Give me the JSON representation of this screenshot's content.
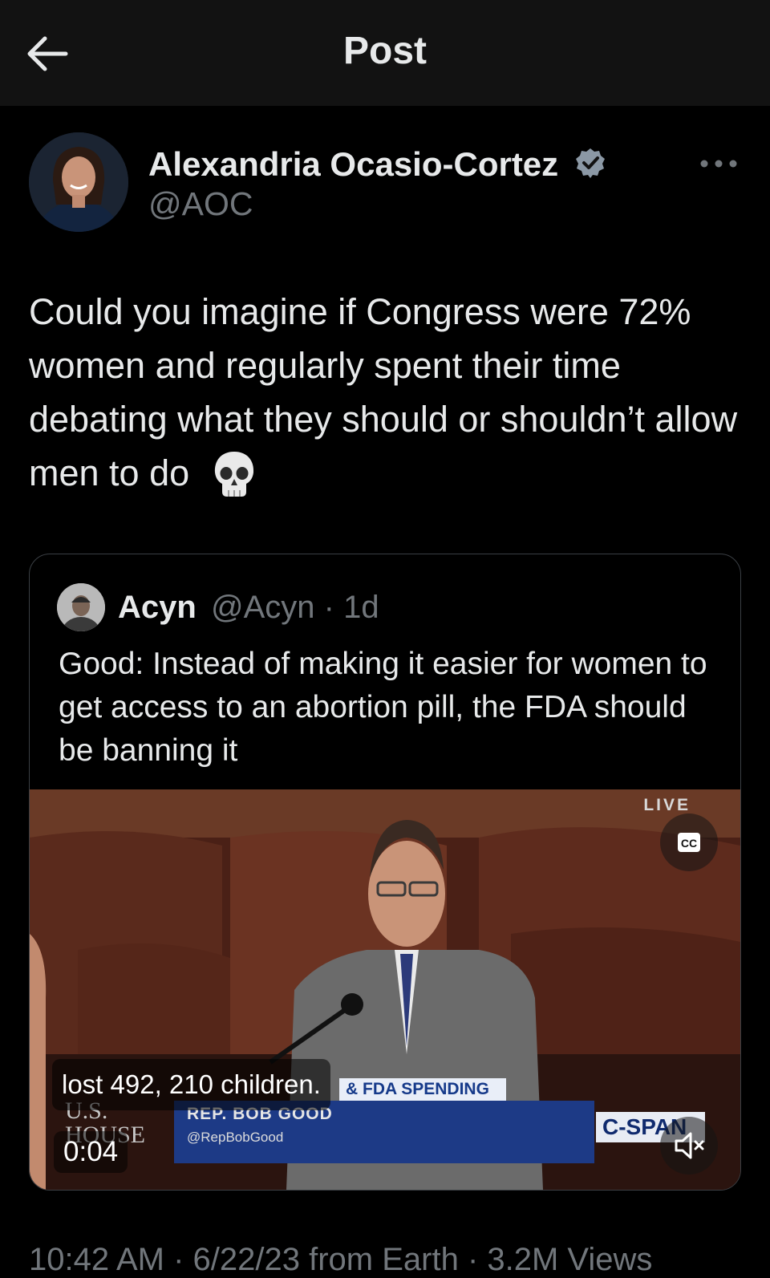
{
  "header": {
    "title": "Post"
  },
  "post": {
    "author_name": "Alexandria Ocasio-Cortez",
    "author_handle": "@AOC",
    "text": "Could you imagine if Congress were 72% women and regularly spent their time debating what they should or shouldn’t allow men to do",
    "emoji": "skull-emoji",
    "verified": true
  },
  "quote": {
    "author_name": "Acyn",
    "meta": "@Acyn · 1d",
    "text": "Good: Instead of making it easier for women to get access to an abortion pill, the FDA should be banning it",
    "video": {
      "live_label": "LIVE",
      "caption": "lost 492, 210 children.",
      "banner_top": "& FDA SPENDING",
      "rep_name": "REP. BOB GOOD",
      "rep_handle": "@RepBobGood",
      "house_logo_line1": "U.S.",
      "house_logo_line2": "HOUSE",
      "network": "C-SPAN",
      "time": "0:04",
      "cc_label": "CC"
    }
  },
  "footer": {
    "meta": "10:42 AM · 6/22/23 from Earth · 3.2M Views"
  },
  "colors": {
    "background": "#000000",
    "topbar": "#121212",
    "text": "#e7e9ea",
    "secondary": "#71767b",
    "verified": "#8b98a5",
    "border": "#3a3f44"
  }
}
